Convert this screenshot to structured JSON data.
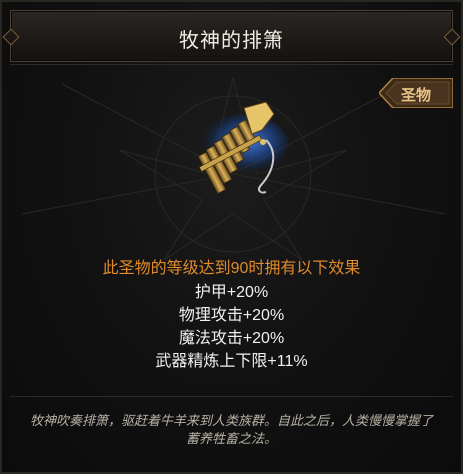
{
  "tooltip": {
    "title": "牧神的排箫",
    "category": "圣物",
    "artifact_icon": "pan-flute-icon",
    "effect_header": "此圣物的等级达到90时拥有以下效果",
    "stats": [
      "护甲+20%",
      "物理攻击+20%",
      "魔法攻击+20%",
      "武器精炼上下限+11%"
    ],
    "lore": "牧神吹奏排箫，驱赶着牛羊来到人类族群。自此之后，人类慢慢掌握了蓄养牲畜之法。"
  },
  "colors": {
    "title": "#f2ede4",
    "category_text": "#e8c48a",
    "effect_header": "#e08a2a",
    "stat_text": "#f0f0f0",
    "lore_text": "#b9b2a6",
    "artifact_gold": "#c8a24a",
    "artifact_blue": "#2a6fd6"
  }
}
